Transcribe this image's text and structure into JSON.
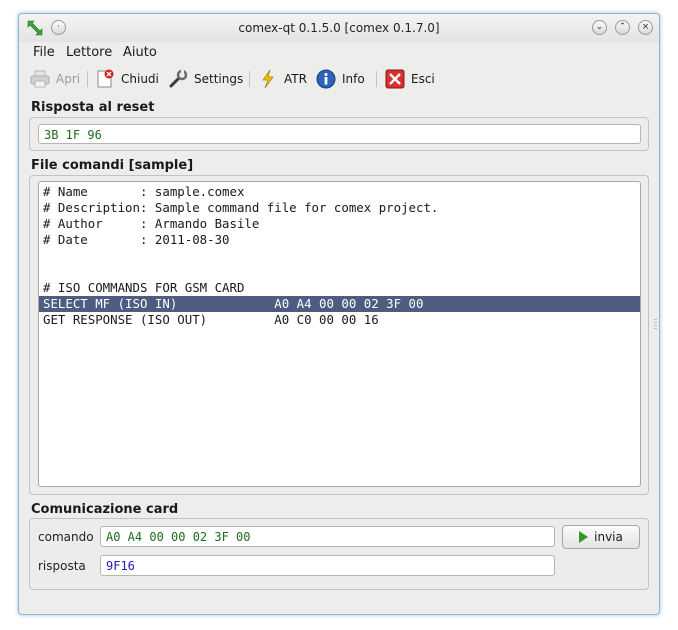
{
  "window": {
    "title": "comex-qt 0.1.5.0 [comex 0.1.7.0]"
  },
  "menu": {
    "file": "File",
    "lettore": "Lettore",
    "aiuto": "Aiuto"
  },
  "toolbar": {
    "apri": "Apri",
    "chiudi": "Chiudi",
    "settings": "Settings",
    "atr": "ATR",
    "info": "Info",
    "esci": "Esci"
  },
  "reset": {
    "title": "Risposta al reset",
    "value": "3B 1F 96"
  },
  "file_comandi": {
    "title": "File comandi [sample]",
    "lines": [
      "# Name       : sample.comex",
      "# Description: Sample command file for comex project.",
      "# Author     : Armando Basile",
      "# Date       : 2011-08-30",
      "",
      "",
      "# ISO COMMANDS FOR GSM CARD",
      "SELECT MF (ISO IN)             A0 A4 00 00 02 3F 00",
      "GET RESPONSE (ISO OUT)         A0 C0 00 00 16"
    ],
    "selected_index": 7
  },
  "comunicazione": {
    "title": "Comunicazione card",
    "comando_label": "comando",
    "comando_value": "A0 A4 00 00 02 3F 00",
    "risposta_label": "risposta",
    "risposta_value": "9F16",
    "invia_label": "invia"
  },
  "colors": {
    "comando_text": "#1f6b1f",
    "risposta_text": "#2020b0",
    "selection": "#4d5c80"
  }
}
